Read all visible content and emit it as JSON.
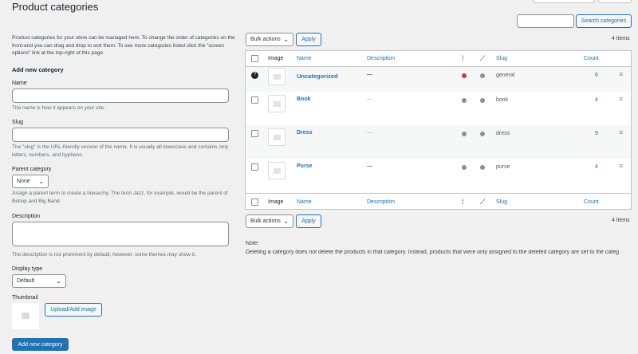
{
  "page": {
    "title": "Product categories"
  },
  "search": {
    "button_label": "Search categories",
    "placeholder": ""
  },
  "intro": "Product categories for your store can be managed here. To change the order of categories on the front-end you can drag and drop to sort them. To see more categories listed click the \"screen options\" link at the top-right of this page.",
  "form": {
    "heading": "Add new category",
    "name_label": "Name",
    "name_help": "The name is how it appears on your site.",
    "slug_label": "Slug",
    "slug_help": "The \"slug\" is the URL-friendly version of the name. It is usually all lowercase and contains only letters, numbers, and hyphens.",
    "parent_label": "Parent category",
    "parent_value": "None",
    "parent_help": "Assign a parent term to create a hierarchy. The term Jazz, for example, would be the parent of Bebop and Big Band.",
    "description_label": "Description",
    "description_help": "The description is not prominent by default; however, some themes may show it.",
    "display_type_label": "Display type",
    "display_type_value": "Default",
    "thumbnail_label": "Thumbnail",
    "upload_button": "Upload/Add image",
    "submit_button": "Add new category"
  },
  "table": {
    "bulk_actions": "Bulk actions",
    "apply": "Apply",
    "items_count": "4 items",
    "columns": {
      "image": "Image",
      "name": "Name",
      "description": "Description",
      "slug": "Slug",
      "count": "Count"
    },
    "rows": [
      {
        "name": "Uncategorized",
        "description": "—",
        "slug": "general",
        "count": "6",
        "dot1": "#d63638"
      },
      {
        "name": "Book",
        "description": "—",
        "slug": "book",
        "count": "4",
        "dot1": "#8c8f94"
      },
      {
        "name": "Dress",
        "description": "—",
        "slug": "dress",
        "count": "9",
        "dot1": "#8c8f94"
      },
      {
        "name": "Purse",
        "description": "—",
        "slug": "purse",
        "count": "4",
        "dot1": "#8c8f94"
      }
    ]
  },
  "note": {
    "label": "Note:",
    "text": "Deleting a category does not delete the products in that category. Instead, products that were only assigned to the deleted category are set to the categ"
  }
}
